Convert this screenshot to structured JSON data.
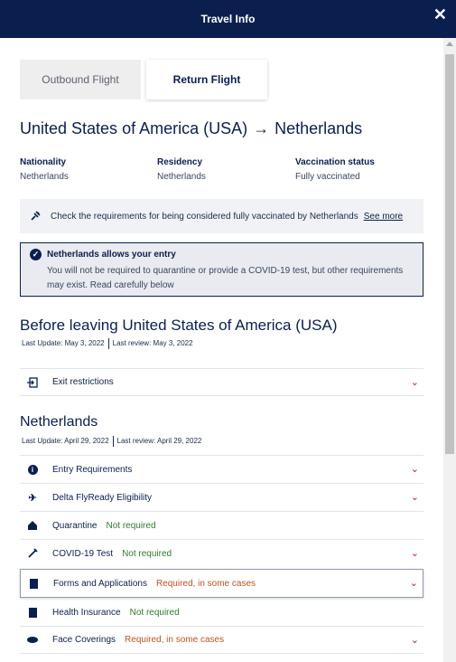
{
  "header": {
    "title": "Travel Info",
    "close_icon": "close-icon"
  },
  "tabs": [
    {
      "label": "Outbound Flight",
      "active": false
    },
    {
      "label": "Return Flight",
      "active": true
    }
  ],
  "route": {
    "origin": "United States of America (USA)",
    "arrow": "→",
    "destination": "Netherlands"
  },
  "traveler": {
    "nationality_label": "Nationality",
    "nationality": "Netherlands",
    "residency_label": "Residency",
    "residency": "Netherlands",
    "vaccination_label": "Vaccination status",
    "vaccination": "Fully vaccinated"
  },
  "vaccination_note": {
    "icon": "syringe-icon",
    "text": "Check the requirements for being considered fully vaccinated by Netherlands",
    "link": "See more"
  },
  "entry": {
    "icon": "check-circle-icon",
    "title": "Netherlands allows your entry",
    "line1": "You will not be required to quarantine or provide a COVID-19 test, but other requirements",
    "line2": "may exist. Read carefully below"
  },
  "before_leaving": {
    "title": "Before leaving United States of America (USA)",
    "last_update": "Last Update: May 3, 2022",
    "last_review": "Last review: May 3, 2022",
    "rows": [
      {
        "label": "Exit restrictions",
        "icon": "exit-icon"
      }
    ]
  },
  "destination_section": {
    "title": "Netherlands",
    "last_update": "Last Update: April 29, 2022",
    "last_review": "Last review: April 29, 2022",
    "rows": [
      {
        "label": "Entry Requirements",
        "icon": "info-icon",
        "status": "",
        "expandable": true
      },
      {
        "label": "Delta FlyReady Eligibility",
        "icon": "plane-icon",
        "status": "",
        "expandable": true
      },
      {
        "label": "Quarantine",
        "icon": "house-icon",
        "status": "Not required",
        "status_color": "#2e7d2e",
        "expandable": false
      },
      {
        "label": "COVID-19 Test",
        "icon": "test-icon",
        "status": "Not required",
        "status_color": "#2e7d2e",
        "expandable": true
      },
      {
        "label": "Forms and Applications",
        "icon": "document-icon",
        "status": "Required, in some cases",
        "status_color": "#c0531f",
        "expandable": true
      },
      {
        "label": "Health Insurance",
        "icon": "insurance-icon",
        "status": "Not required",
        "status_color": "#2e7d2e",
        "expandable": false
      },
      {
        "label": "Face Coverings",
        "icon": "mask-icon",
        "status": "Required, in some cases",
        "status_color": "#c0531f",
        "expandable": true
      }
    ]
  },
  "chevron_icon": "chevron-down-icon",
  "colors": {
    "header_bg": "#0b1f4f",
    "accent_red": "#c8102e",
    "green": "#2e7d2e",
    "orange": "#c0531f"
  }
}
